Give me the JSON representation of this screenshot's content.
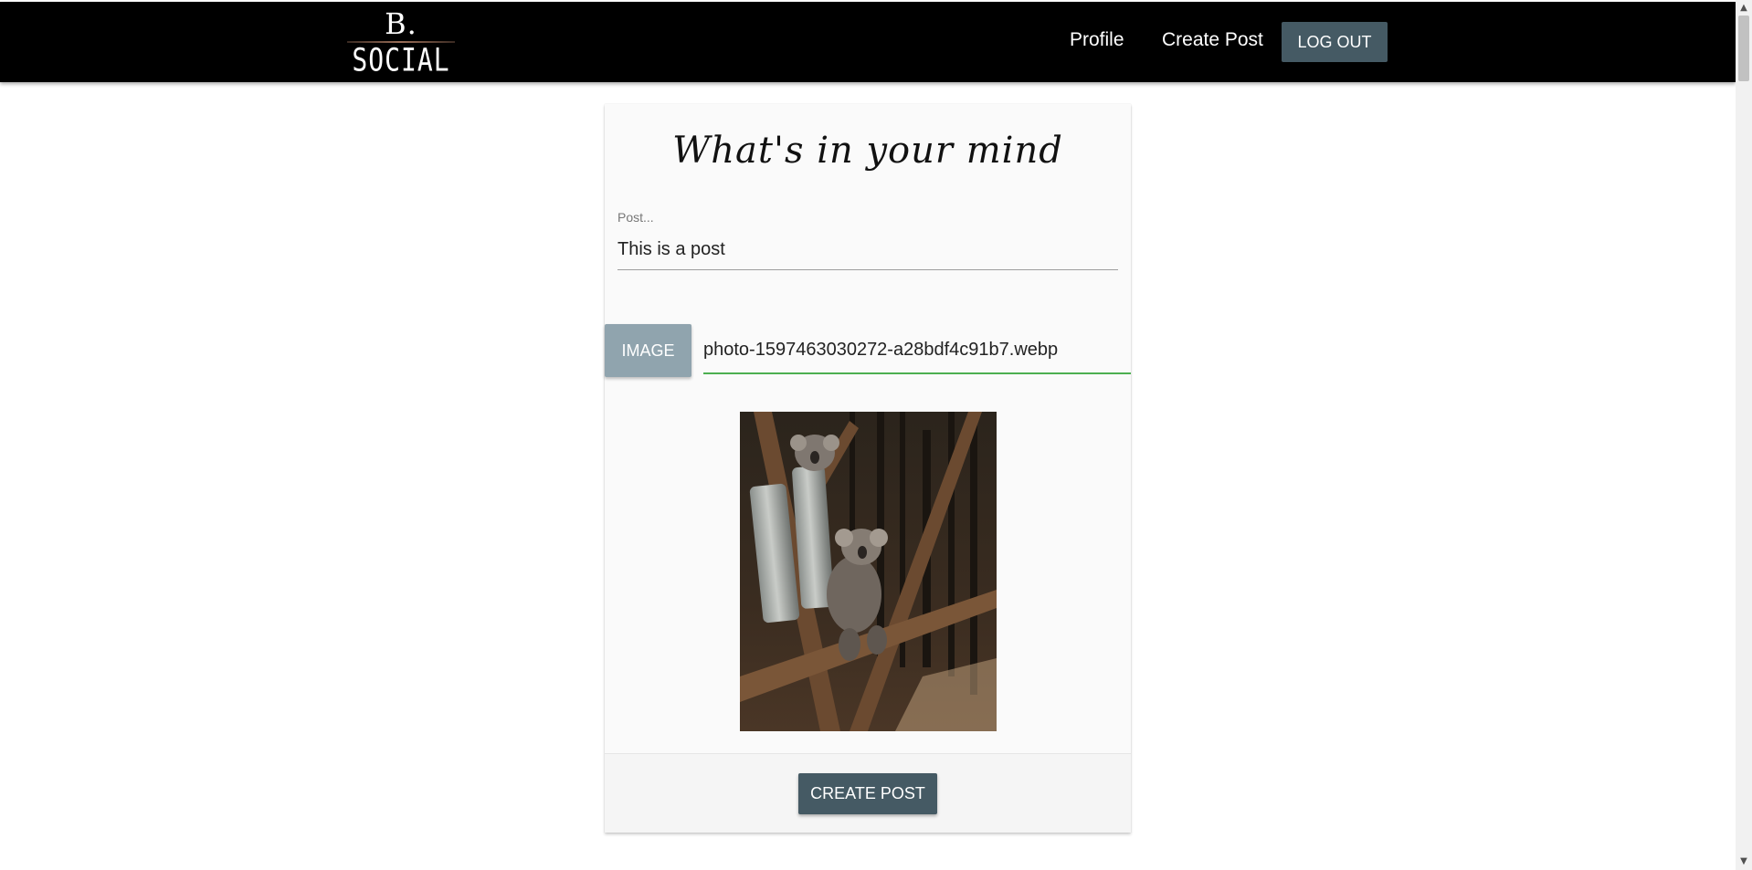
{
  "nav": {
    "logo_top": "B.",
    "logo_bottom": "SOCIAL",
    "profile_label": "Profile",
    "create_post_label": "Create Post",
    "logout_label": "LOG OUT"
  },
  "form": {
    "title": "What's in your mind",
    "post_label": "Post...",
    "post_value": "This is a post",
    "image_button_label": "IMAGE",
    "file_name": "photo-1597463030272-a28bdf4c91b7.webp",
    "submit_label": "CREATE POST"
  },
  "colors": {
    "navbar": "#000000",
    "primary_button": "#455a64",
    "image_button": "#90a4ae",
    "valid_underline": "#4caf50"
  },
  "icons": {
    "scroll_up": "scroll-up-arrow-icon",
    "scroll_down": "scroll-down-arrow-icon"
  }
}
